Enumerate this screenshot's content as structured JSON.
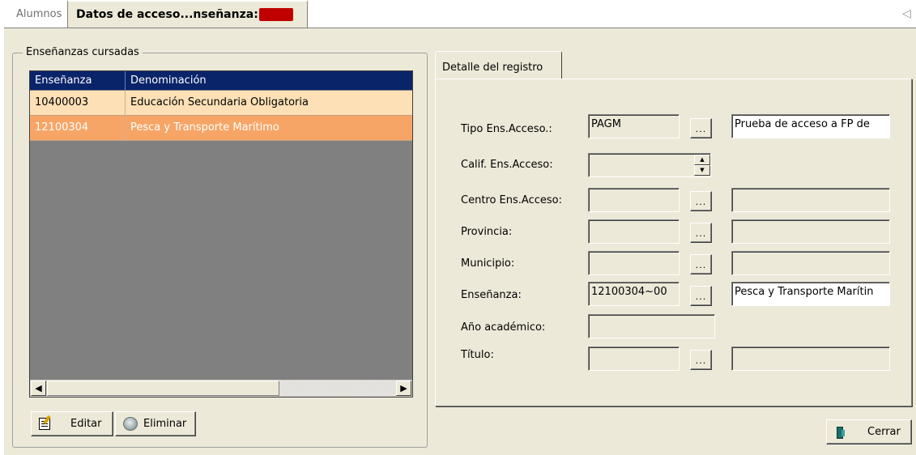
{
  "tabs": {
    "alumnos": "Alumnos",
    "active": "Datos de acceso...nseñanza:"
  },
  "group": {
    "title": "Enseñanzas cursadas"
  },
  "grid": {
    "headers": [
      "Enseñanza",
      "Denominación"
    ],
    "rows": [
      {
        "code": "10400003",
        "name": "Educación Secundaria Obligatoria"
      },
      {
        "code": "12100304",
        "name": "Pesca y Transporte Marítimo"
      }
    ]
  },
  "buttons": {
    "editar": "Editar",
    "eliminar": "Eliminar",
    "cerrar": "Cerrar",
    "browse": "..."
  },
  "detail": {
    "tab_label": "Detalle del registro",
    "fields": {
      "tipo": {
        "label": "Tipo Ens.Acceso.:",
        "code": "PAGM",
        "desc": "Prueba de acceso a FP de"
      },
      "calif": {
        "label": "Calif. Ens.Acceso:",
        "value": ""
      },
      "centro": {
        "label": "Centro Ens.Acceso:",
        "code": "",
        "desc": ""
      },
      "provincia": {
        "label": "Provincia:",
        "code": "",
        "desc": ""
      },
      "municipio": {
        "label": "Municipio:",
        "code": "",
        "desc": ""
      },
      "ensenanza": {
        "label": "Enseñanza:",
        "code": "12100304~00",
        "desc": "Pesca y Transporte Marítin"
      },
      "anio": {
        "label": "Año académico:",
        "value": ""
      },
      "titulo": {
        "label": "Título:",
        "code": "",
        "desc": ""
      }
    }
  },
  "colors": {
    "background": "#ece9d8",
    "grid_header": "#0a246a",
    "row_normal": "#fde0b6",
    "row_selected": "#f7a566",
    "grid_empty": "#808080",
    "redacted": "#c00000"
  }
}
